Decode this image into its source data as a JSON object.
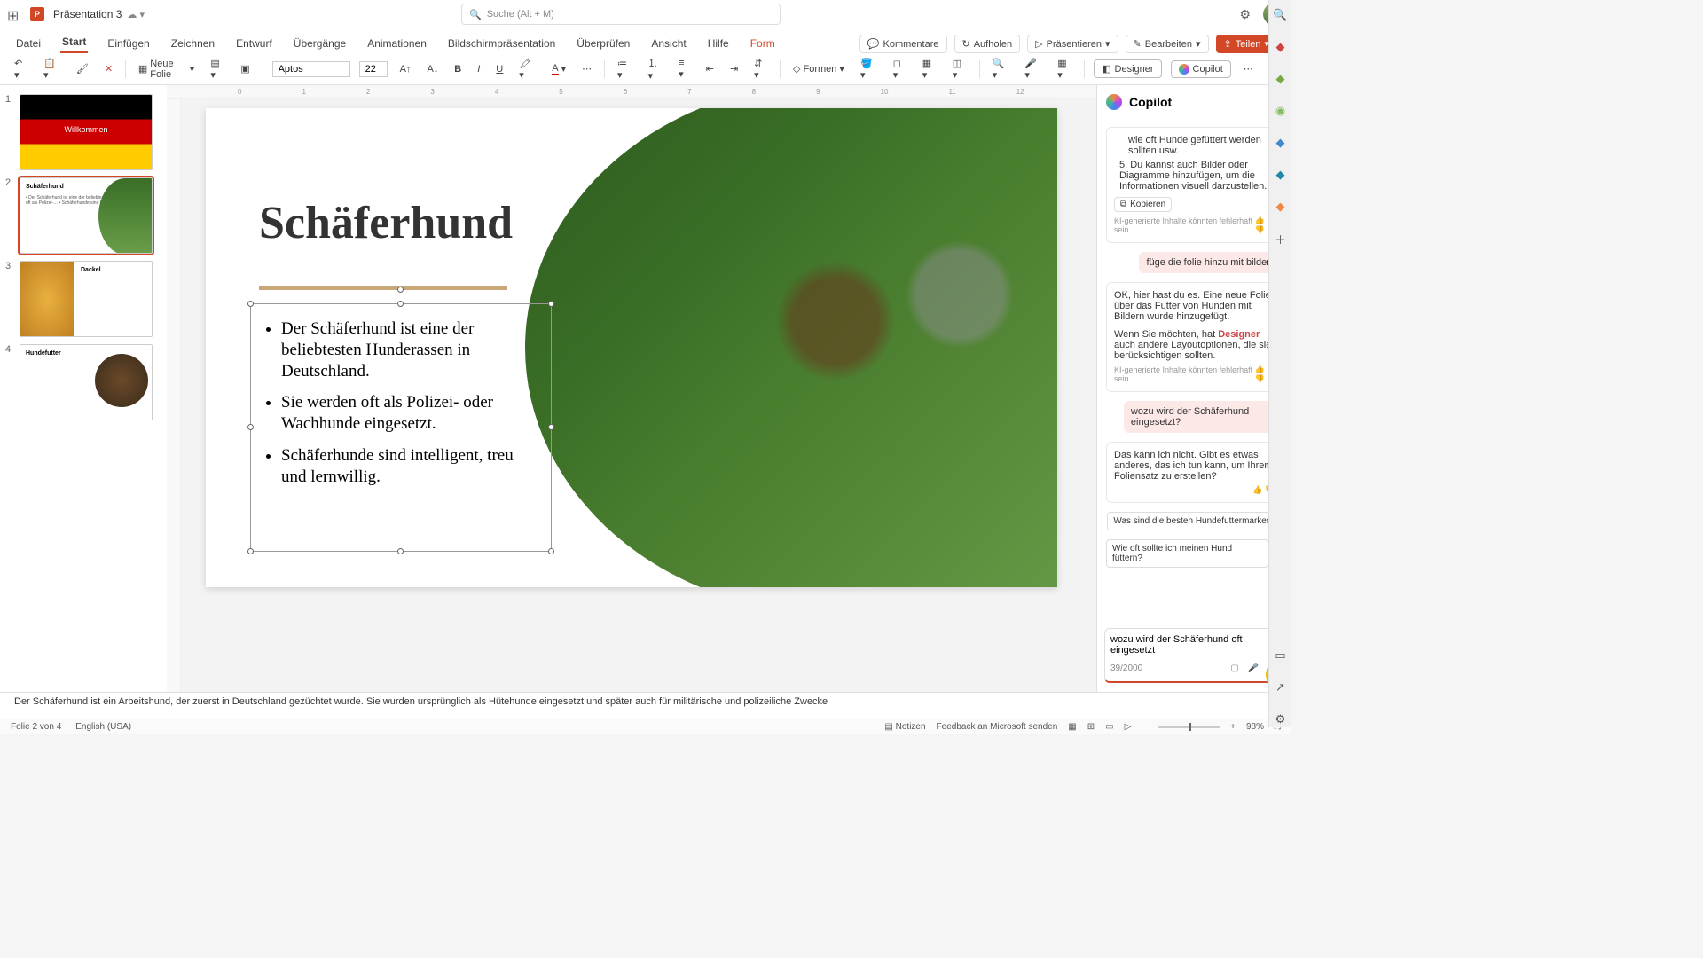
{
  "titlebar": {
    "title": "Präsentation 3",
    "search_placeholder": "Suche (Alt + M)"
  },
  "ribbon_tabs": [
    "Datei",
    "Start",
    "Einfügen",
    "Zeichnen",
    "Entwurf",
    "Übergänge",
    "Animationen",
    "Bildschirmpräsentation",
    "Überprüfen",
    "Ansicht",
    "Hilfe",
    "Form"
  ],
  "ribbon_active": 1,
  "ribbon_right": {
    "comments": "Kommentare",
    "catchup": "Aufholen",
    "present": "Präsentieren",
    "edit": "Bearbeiten",
    "share": "Teilen"
  },
  "ribbon": {
    "new_slide": "Neue Folie",
    "font": "Aptos",
    "size": "22",
    "shapes": "Formen",
    "designer": "Designer",
    "copilot": "Copilot"
  },
  "thumbs": [
    {
      "n": "1",
      "title": "Willkommen"
    },
    {
      "n": "2",
      "title": "Schäferhund",
      "body": "• Der Schäferhund ist eine der beliebtesten…\n• Sie werden oft als Polizei-…\n• Schäferhunde sind intelligent…"
    },
    {
      "n": "3",
      "title": "Dackel",
      "body": ""
    },
    {
      "n": "4",
      "title": "Hundefutter",
      "body": ""
    }
  ],
  "ruler_h": [
    "0",
    "1",
    "2",
    "3",
    "4",
    "5",
    "6",
    "7",
    "8",
    "9",
    "10",
    "11",
    "12"
  ],
  "slide": {
    "title": "Schäferhund",
    "bullets": [
      "Der Schäferhund ist eine der beliebtesten Hunderassen in Deutschland.",
      "Sie werden oft als Polizei- oder Wachhunde eingesetzt.",
      "Schäferhunde sind intelligent, treu und lernwillig."
    ]
  },
  "copilot": {
    "title": "Copilot",
    "partial_top": "wie oft Hunde gefüttert werden sollten usw.",
    "bullet5": "Du kannst auch Bilder oder Diagramme hinzufügen, um die Informationen visuell darzustellen.",
    "copy": "Kopieren",
    "disclaimer": "KI-generierte Inhalte könnten fehlerhaft sein.",
    "user1": "füge die folie hinzu mit bildern",
    "assist1a": "OK, hier hast du es. Eine neue Folie über das Futter von Hunden mit Bildern wurde hinzugefügt.",
    "assist1b_pre": "Wenn Sie möchten, hat ",
    "assist1b_link": "Designer",
    "assist1b_post": " auch andere Layoutoptionen, die sie berücksichtigen sollten.",
    "user2": "wozu wird der Schäferhund eingesetzt?",
    "assist2": "Das kann ich nicht. Gibt es etwas anderes, das ich tun kann, um Ihren Foliensatz zu erstellen?",
    "suggest1": "Was sind die besten Hundefuttermarken?",
    "suggest2": "Wie oft sollte ich meinen Hund füttern?",
    "input": "wozu wird der Schäferhund oft eingesetzt",
    "counter": "39/2000"
  },
  "notes": "Der Schäferhund ist ein Arbeitshund, der zuerst in Deutschland gezüchtet wurde. Sie wurden ursprünglich als Hütehunde eingesetzt und später auch für militärische und polizeiliche Zwecke",
  "status": {
    "slide": "Folie 2 von 4",
    "lang": "English (USA)",
    "notes": "Notizen",
    "feedback": "Feedback an Microsoft senden",
    "zoom": "98%"
  }
}
